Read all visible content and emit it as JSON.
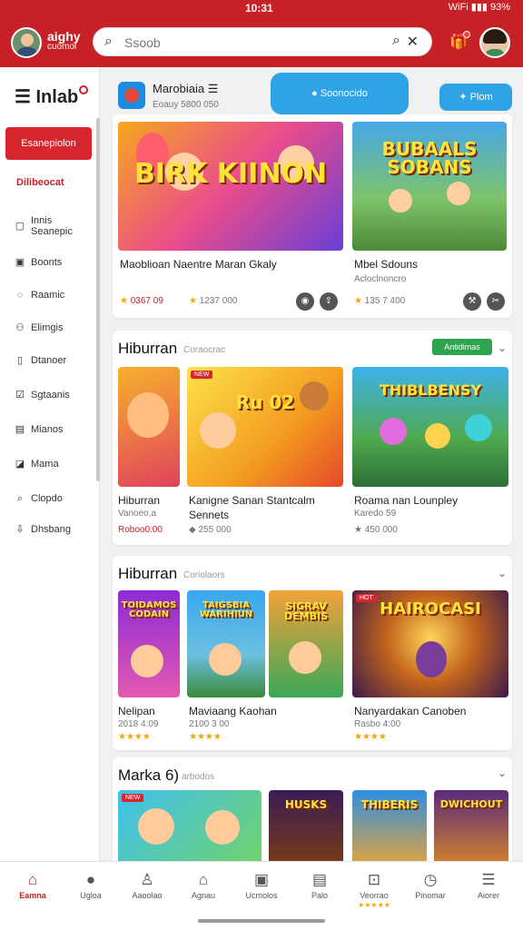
{
  "status_bar": {
    "time": "10:31",
    "icons": "WiFi ▮▮▮ 93%"
  },
  "header": {
    "brand_line1": "aighy",
    "brand_line2": "cuomol",
    "search_placeholder": "Ssoob",
    "search_icon": "search-icon",
    "notification_icon": "gift-icon",
    "accent": "#c62127"
  },
  "sidebar": {
    "title": "Inlab",
    "primary_button": "Esanepiolon",
    "active_item": "Dilibeocat",
    "items": [
      {
        "icon": "square-icon",
        "label1": "Innis",
        "label2": "Seanepic"
      },
      {
        "icon": "image-icon",
        "label1": "Boonts"
      },
      {
        "icon": "chat-icon",
        "label1": "Raamic"
      },
      {
        "icon": "users-icon",
        "label1": "Elimgis"
      },
      {
        "icon": "document-icon",
        "label1": "Dtanoer"
      },
      {
        "icon": "edit-icon",
        "label1": "Sgtaanis"
      },
      {
        "icon": "calendar-icon",
        "label1": "Mianos"
      },
      {
        "icon": "share-icon",
        "label1": "Mama"
      },
      {
        "icon": "search-icon",
        "label1": "Clopdo"
      },
      {
        "icon": "download-icon",
        "label1": "Dhsbang"
      }
    ]
  },
  "promo": {
    "title": "Marobiaia ☰",
    "subtitle": "Eoauy 5800 050",
    "button1": "Soonocido",
    "button2": "Plom"
  },
  "featured": [
    {
      "art": "BIRK KIINON",
      "title": "Maoblioan Naentre Maran Gkaly",
      "rating": "0367 09",
      "count": "1237 000"
    },
    {
      "art": "BUBAALS SOBANS",
      "title": "Mbel Sdouns",
      "subtitle": "Acloclnoncro",
      "rating": "135 7 400"
    }
  ],
  "section1": {
    "title": "Hiburran",
    "subtitle": "Coraocrac",
    "badge": "Antidimas",
    "games": [
      {
        "title": "Hiburran",
        "sub": "Vanoeo,a",
        "meta": "Roboo0:00"
      },
      {
        "art": "Ru 02",
        "title": "Kanigne Sanan Stantcalm",
        "sub": "Sennets",
        "meta": "255 000"
      },
      {
        "art": "THIBLBENSY",
        "title": "Roama nan Lounpley",
        "sub": "Karedo 59",
        "meta": "★ 450 000"
      }
    ]
  },
  "section2": {
    "title": "Hiburran",
    "subtitle": "Coriolaors",
    "games": [
      {
        "art": "TOIDAMOS CODAIN",
        "title": "Nelipan",
        "meta": "2018 4:09",
        "stars": "★★★★"
      },
      {
        "art": "TAIGSBIA WARIHIUN",
        "title": "Maviaang Kaohan",
        "meta": "2100 3 00",
        "stars": "★★★★"
      },
      {
        "art": "SIGRAV DEMBIS",
        "title": "",
        "meta": "",
        "stars": ""
      },
      {
        "art": "HAIROCASI",
        "title": "Nanyardakan Canoben",
        "meta": "Rasbo 4:00",
        "stars": "★★★★"
      }
    ]
  },
  "section3": {
    "title": "Marka 6)",
    "subtitle": "arbodos",
    "games": [
      {
        "art": ""
      },
      {
        "art": "HUSKS"
      },
      {
        "art": "THIBERIS"
      },
      {
        "art": "DWICHOUT"
      }
    ]
  },
  "bottom_nav": [
    {
      "icon": "home-icon",
      "label": "Eamna",
      "active": true
    },
    {
      "icon": "gift-icon",
      "label": "Ugloa"
    },
    {
      "icon": "person-icon",
      "label": "Aaoolao"
    },
    {
      "icon": "store-icon",
      "label": "Agnau"
    },
    {
      "icon": "tablet-icon",
      "label": "Ucmolos"
    },
    {
      "icon": "doc-icon",
      "label": "Palo"
    },
    {
      "icon": "shop-icon",
      "label": "Veorrao",
      "stars": "★★★★★"
    },
    {
      "icon": "clock-icon",
      "label": "Pinomar"
    },
    {
      "icon": "settings-icon",
      "label": "Aiorer"
    }
  ]
}
